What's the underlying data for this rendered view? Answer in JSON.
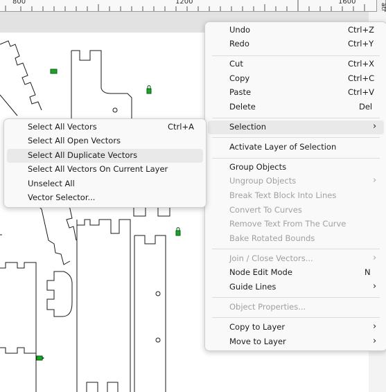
{
  "ruler": {
    "labels": [
      "800",
      "1200",
      "1600"
    ]
  },
  "side_tab": {
    "label": "aths"
  },
  "context_menu": {
    "items": [
      {
        "label": "Undo",
        "shortcut": "Ctrl+Z"
      },
      {
        "label": "Redo",
        "shortcut": "Ctrl+Y"
      },
      {
        "label": "Cut",
        "shortcut": "Ctrl+X"
      },
      {
        "label": "Copy",
        "shortcut": "Ctrl+C"
      },
      {
        "label": "Paste",
        "shortcut": "Ctrl+V"
      },
      {
        "label": "Delete",
        "shortcut": "Del"
      },
      {
        "label": "Selection",
        "arrow": "›"
      },
      {
        "label": "Activate Layer of Selection"
      },
      {
        "label": "Group Objects"
      },
      {
        "label": "Ungroup Objects",
        "arrow": "›"
      },
      {
        "label": "Break Text Block Into Lines"
      },
      {
        "label": "Convert To Curves"
      },
      {
        "label": "Remove Text From The Curve"
      },
      {
        "label": "Bake Rotated Bounds"
      },
      {
        "label": "Join / Close Vectors...",
        "arrow": "›"
      },
      {
        "label": "Node Edit Mode",
        "shortcut": "N"
      },
      {
        "label": "Guide Lines",
        "arrow": "›"
      },
      {
        "label": "Object Properties..."
      },
      {
        "label": "Copy to Layer",
        "arrow": "›"
      },
      {
        "label": "Move to Layer",
        "arrow": "›"
      }
    ]
  },
  "selection_submenu": {
    "items": [
      {
        "label": "Select All Vectors",
        "shortcut": "Ctrl+A"
      },
      {
        "label": "Select All Open Vectors"
      },
      {
        "label": "Select All Duplicate Vectors"
      },
      {
        "label": "Select All Vectors On Current Layer"
      },
      {
        "label": "Unselect All"
      },
      {
        "label": "Vector Selector..."
      }
    ]
  },
  "colors": {
    "lock_icon": "#1aa52a",
    "menu_bg": "#f9f9f9",
    "highlight": "#e9e9e9",
    "disabled_text": "#a0a0a0"
  }
}
